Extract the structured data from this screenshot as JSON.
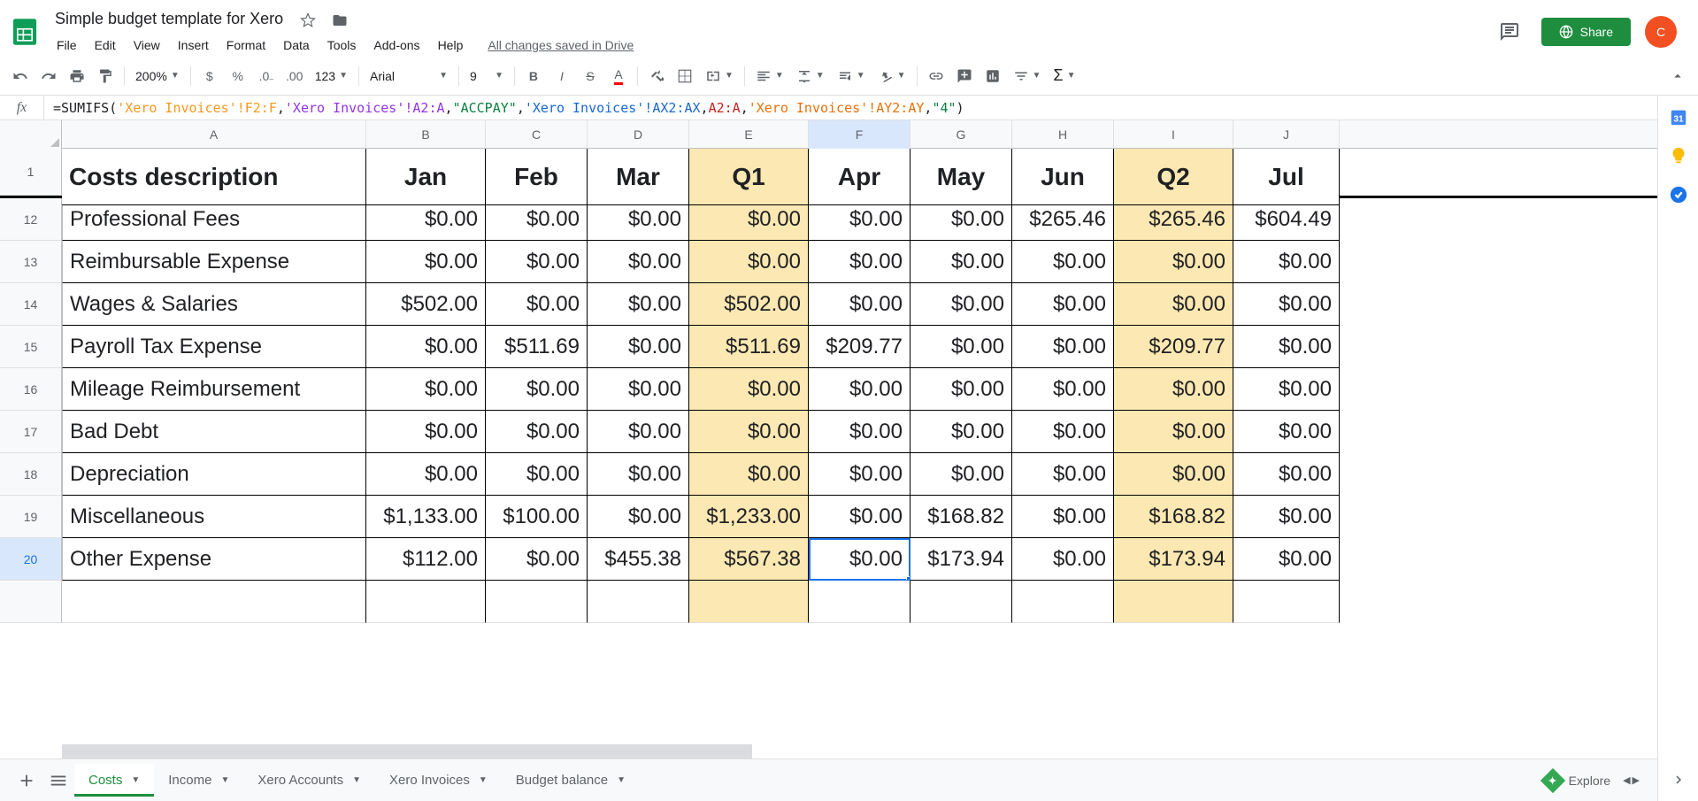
{
  "doc_title": "Simple budget template for Xero",
  "saved_text": "All changes saved in Drive",
  "menu": [
    "File",
    "Edit",
    "View",
    "Insert",
    "Format",
    "Data",
    "Tools",
    "Add-ons",
    "Help"
  ],
  "share_label": "Share",
  "avatar_initial": "C",
  "toolbar": {
    "zoom": "200%",
    "font": "Arial",
    "font_size": "9",
    "more_formats": "123"
  },
  "formula": {
    "prefix": "=SUMIFS(",
    "parts": [
      {
        "text": "'Xero Invoices'!F2:F",
        "cls": "fm-ref"
      },
      {
        "text": ","
      },
      {
        "text": "'Xero Invoices'!A2:A",
        "cls": "fm-ref4"
      },
      {
        "text": ","
      },
      {
        "text": "\"ACCPAY\"",
        "cls": "fm-str"
      },
      {
        "text": ","
      },
      {
        "text": "'Xero Invoices'!AX2:AX",
        "cls": "fm-ref3"
      },
      {
        "text": ","
      },
      {
        "text": "A2:A",
        "cls": "fm-ref2"
      },
      {
        "text": ","
      },
      {
        "text": "'Xero Invoices'!AY2:AY",
        "cls": "fm-ref5"
      },
      {
        "text": ","
      },
      {
        "text": "\"4\"",
        "cls": "fm-str"
      },
      {
        "text": ")"
      }
    ]
  },
  "columns": [
    {
      "letter": "A",
      "w": "w-a"
    },
    {
      "letter": "B",
      "w": "w-b"
    },
    {
      "letter": "C",
      "w": "w-c"
    },
    {
      "letter": "D",
      "w": "w-d"
    },
    {
      "letter": "E",
      "w": "w-e",
      "q": true
    },
    {
      "letter": "F",
      "w": "w-f",
      "sel": true
    },
    {
      "letter": "G",
      "w": "w-g"
    },
    {
      "letter": "H",
      "w": "w-h"
    },
    {
      "letter": "I",
      "w": "w-i",
      "q": true
    },
    {
      "letter": "J",
      "w": "w-j"
    }
  ],
  "header_row": {
    "num": "1",
    "cells": [
      "Costs description",
      "Jan",
      "Feb",
      "Mar",
      "Q1",
      "Apr",
      "May",
      "Jun",
      "Q2",
      "Jul"
    ]
  },
  "rows": [
    {
      "num": "12",
      "cells": [
        "Professional Fees",
        "$0.00",
        "$0.00",
        "$0.00",
        "$0.00",
        "$0.00",
        "$0.00",
        "$265.46",
        "$265.46",
        "$604.49"
      ]
    },
    {
      "num": "13",
      "cells": [
        "Reimbursable Expense",
        "$0.00",
        "$0.00",
        "$0.00",
        "$0.00",
        "$0.00",
        "$0.00",
        "$0.00",
        "$0.00",
        "$0.00"
      ]
    },
    {
      "num": "14",
      "cells": [
        "Wages & Salaries",
        "$502.00",
        "$0.00",
        "$0.00",
        "$502.00",
        "$0.00",
        "$0.00",
        "$0.00",
        "$0.00",
        "$0.00"
      ]
    },
    {
      "num": "15",
      "cells": [
        "Payroll Tax Expense",
        "$0.00",
        "$511.69",
        "$0.00",
        "$511.69",
        "$209.77",
        "$0.00",
        "$0.00",
        "$209.77",
        "$0.00"
      ]
    },
    {
      "num": "16",
      "cells": [
        "Mileage Reimbursement",
        "$0.00",
        "$0.00",
        "$0.00",
        "$0.00",
        "$0.00",
        "$0.00",
        "$0.00",
        "$0.00",
        "$0.00"
      ]
    },
    {
      "num": "17",
      "cells": [
        "Bad Debt",
        "$0.00",
        "$0.00",
        "$0.00",
        "$0.00",
        "$0.00",
        "$0.00",
        "$0.00",
        "$0.00",
        "$0.00"
      ]
    },
    {
      "num": "18",
      "cells": [
        "Depreciation",
        "$0.00",
        "$0.00",
        "$0.00",
        "$0.00",
        "$0.00",
        "$0.00",
        "$0.00",
        "$0.00",
        "$0.00"
      ]
    },
    {
      "num": "19",
      "cells": [
        "Miscellaneous",
        "$1,133.00",
        "$100.00",
        "$0.00",
        "$1,233.00",
        "$0.00",
        "$168.82",
        "$0.00",
        "$168.82",
        "$0.00"
      ]
    },
    {
      "num": "20",
      "sel": true,
      "cells": [
        "Other Expense",
        "$112.00",
        "$0.00",
        "$455.38",
        "$567.38",
        "$0.00",
        "$173.94",
        "$0.00",
        "$173.94",
        "$0.00"
      ]
    }
  ],
  "selected_cell": {
    "row": "20",
    "col": "F"
  },
  "sheets": [
    {
      "name": "Costs",
      "active": true
    },
    {
      "name": "Income"
    },
    {
      "name": "Xero Accounts"
    },
    {
      "name": "Xero Invoices"
    },
    {
      "name": "Budget balance"
    }
  ],
  "explore_label": "Explore"
}
